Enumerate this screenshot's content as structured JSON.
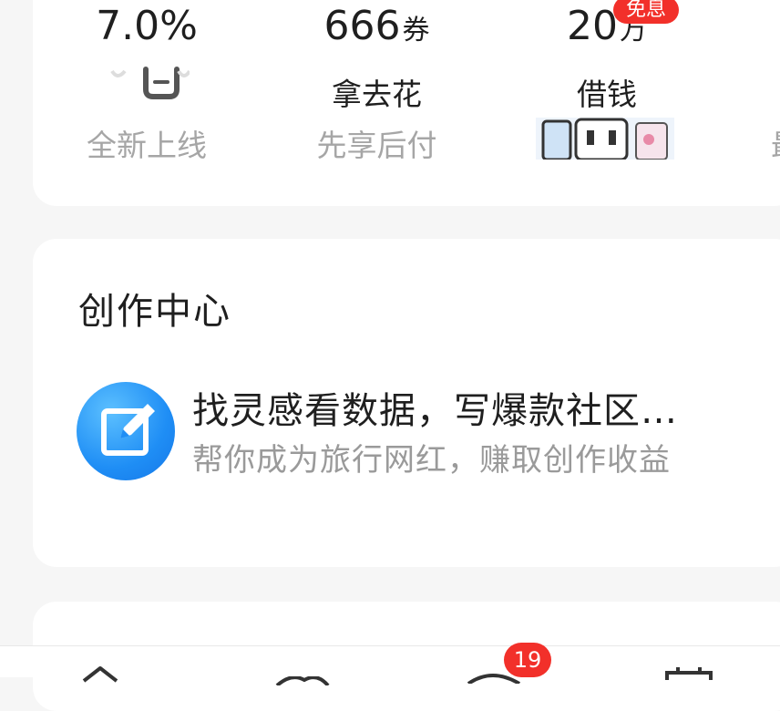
{
  "finance": {
    "items": [
      {
        "value": "7.0%",
        "unit": "",
        "label": "",
        "sub": "全新上线",
        "icon": "smile-face-icon"
      },
      {
        "value": "666",
        "unit": "券",
        "label": "拿去花",
        "sub": "先享后付"
      },
      {
        "value": "20",
        "unit": "万",
        "label": "借钱",
        "sub": "",
        "badge": "免息",
        "art": "cartoon-robot-banner"
      }
    ],
    "edge_partial_label": "最"
  },
  "creation": {
    "title": "创作中心",
    "icon": "edit-pen-icon",
    "headline": "找灵感看数据，写爆款社区…",
    "subline": "帮你成为旅行网红，赚取创作收益"
  },
  "tabbar": {
    "tabs": [
      {
        "icon": "home-icon"
      },
      {
        "icon": "cloud-icon"
      },
      {
        "icon": "message-icon",
        "badge": "19"
      },
      {
        "icon": "calendar-icon"
      }
    ]
  },
  "colors": {
    "accent_blue": "#1f8ef5",
    "badge_red": "#f2302a",
    "muted_text": "#a6a6a6"
  }
}
